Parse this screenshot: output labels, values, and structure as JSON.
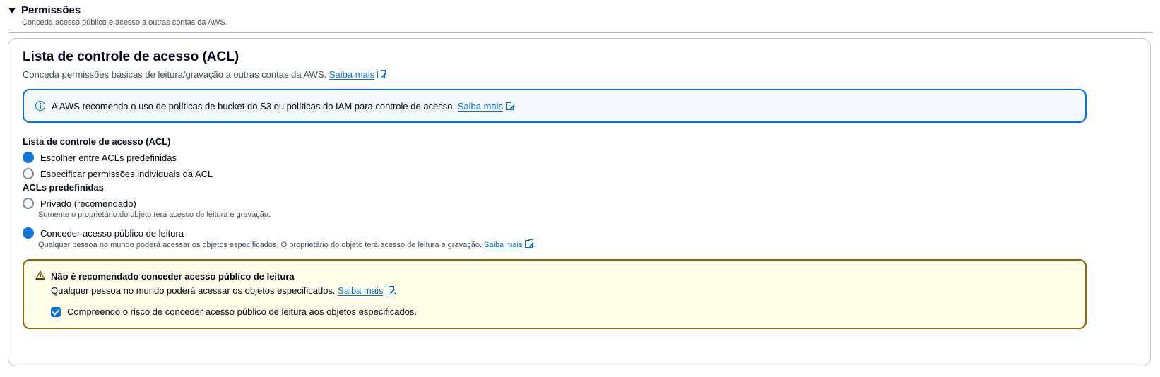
{
  "section": {
    "title": "Permissões",
    "description": "Conceda acesso público e acesso a outras contas da AWS."
  },
  "acl_card": {
    "title": "Lista de controle de acesso (ACL)",
    "description": "Conceda permissões básicas de leitura/gravação a outras contas da AWS.",
    "learn_more": "Saiba mais"
  },
  "info_alert": {
    "text": "A AWS recomenda o uso de políticas de bucket do S3 ou políticas do IAM para controle de acesso.",
    "learn_more": "Saiba mais"
  },
  "acl_field": {
    "label": "Lista de controle de acesso (ACL)",
    "options": [
      {
        "label": "Escolher entre ACLs predefinidas",
        "selected": true
      },
      {
        "label": "Especificar permissões individuais da ACL",
        "selected": false
      }
    ]
  },
  "predefined_acls": {
    "label": "ACLs predefinidas",
    "options": [
      {
        "label": "Privado (recomendado)",
        "description": "Somente o proprietário do objeto terá acesso de leitura e gravação.",
        "selected": false
      },
      {
        "label": "Conceder acesso público de leitura",
        "description": "Qualquer pessoa no mundo poderá acessar os objetos especificados. O proprietário do objeto terá acesso de leitura e gravação.",
        "learn_more": "Saiba mais",
        "selected": true
      }
    ]
  },
  "warning_alert": {
    "title": "Não é recomendado conceder acesso público de leitura",
    "text": "Qualquer pessoa no mundo poderá acessar os objetos especificados.",
    "learn_more": "Saiba mais",
    "checkbox_label": "Compreendo o risco de conceder acesso público de leitura aos objetos especificados.",
    "checkbox_checked": true
  },
  "colors": {
    "link": "#0972d3",
    "info_border": "#0972d3",
    "info_bg": "#f2f8fd",
    "warning_border": "#8d6605",
    "warning_bg": "#fffce9",
    "text": "#000716",
    "secondary_text": "#414d5c"
  }
}
